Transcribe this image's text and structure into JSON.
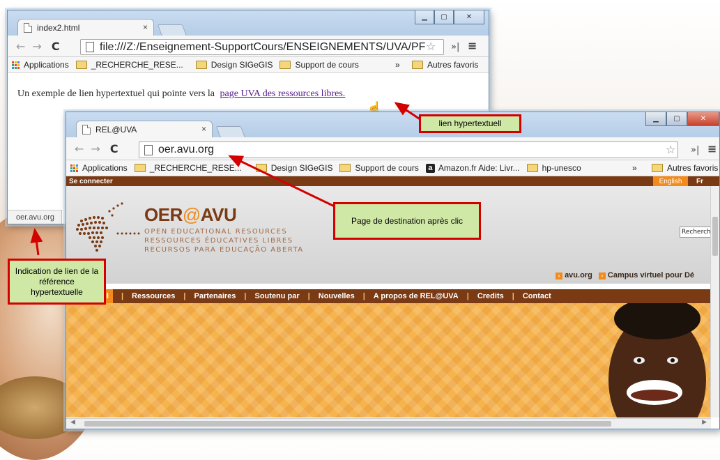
{
  "window1": {
    "tab_title": "index2.html",
    "tab_close": "×",
    "url": "file:///Z:/Enseignement-SupportCours/ENSEIGNEMENTS/UVA/PF",
    "bookmarks": [
      "Applications",
      "_RECHERCHE_RESE...",
      "Design SIGeGIS",
      "Support de cours"
    ],
    "bookmarks_overflow": "»",
    "other_bookmarks": "Autres favoris",
    "body_text": "Un exemple de lien hypertextuel qui pointe vers la",
    "link_text": "page UVA des ressources libres.",
    "status_url": "oer.avu.org"
  },
  "window2": {
    "tab_title": "REL@UVA",
    "tab_close": "×",
    "url": "oer.avu.org",
    "bookmarks": [
      "Applications",
      "_RECHERCHE_RESE...",
      "Design SIGeGIS",
      "Support de cours",
      "Amazon.fr Aide: Livr...",
      "hp-unesco"
    ],
    "bookmarks_overflow": "»",
    "other_bookmarks": "Autres favoris",
    "site": {
      "login": "Se connecter",
      "lang_english": "English",
      "lang_fr": "Fr",
      "logo_text_a": "OER",
      "logo_text_at": "@",
      "logo_text_b": "AVU",
      "tagline_en": "OPEN EDUCATIONAL RESOURCES",
      "tagline_fr": "RESSOURCES ÉDUCATIVES LIBRES",
      "tagline_pt": "RECURSOS PARA EDUCAÇÃO ABERTA",
      "search_label": "Recherche",
      "links": [
        "avu.org",
        "Campus virtuel pour Dé"
      ],
      "nav": [
        "ueil",
        "Ressources",
        "Partenaires",
        "Soutenu par",
        "Nouvelles",
        "A propos de REL@UVA",
        "Credits",
        "Contact"
      ]
    }
  },
  "callouts": {
    "link": "lien hypertextuell",
    "destination": "Page de destination après clic",
    "indication": "Indication de lien de la référence hypertextuelle"
  },
  "colors": {
    "accent_red": "#d40000",
    "callout_fill": "#cfe8a6",
    "oer_brown": "#7a3a14",
    "oer_orange": "#f28a1c"
  }
}
